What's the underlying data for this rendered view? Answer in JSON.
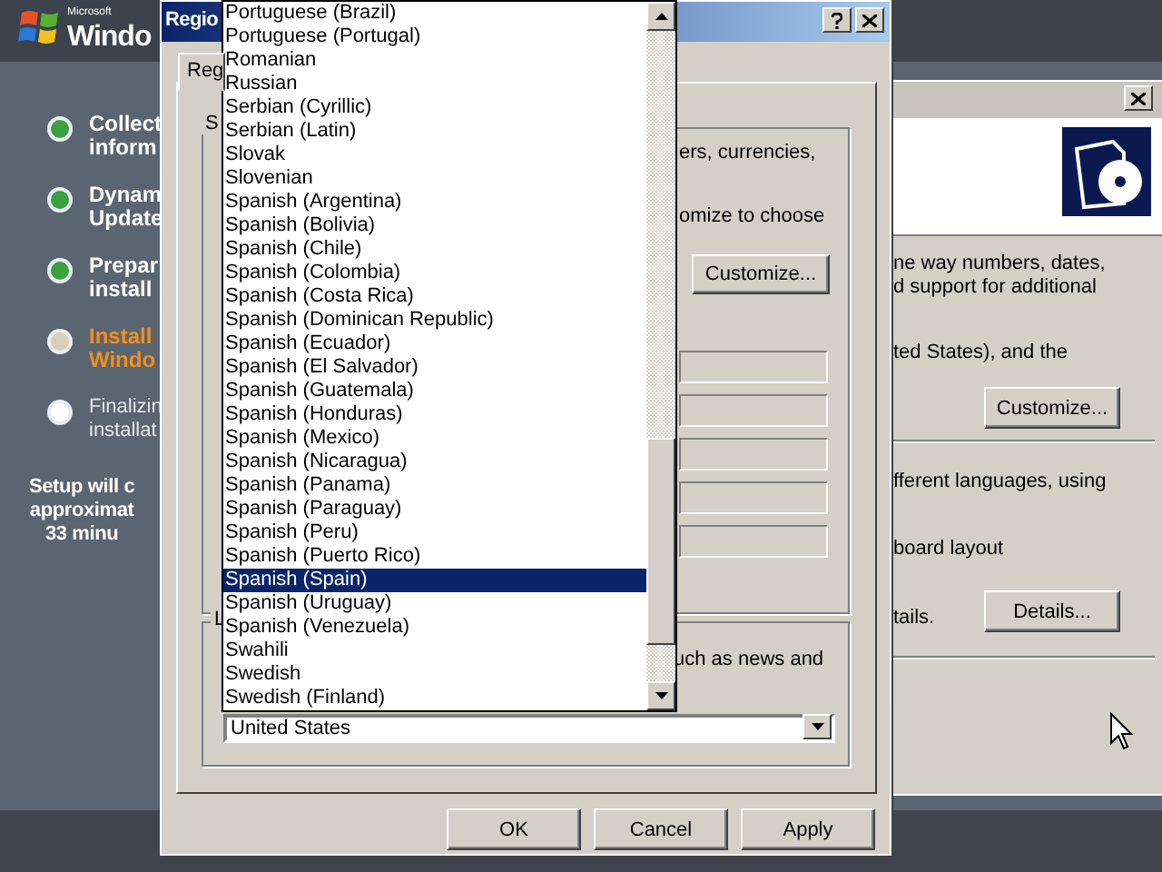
{
  "setup": {
    "brand_small": "Microsoft",
    "brand": "Windo",
    "steps": [
      {
        "lines": [
          "Collect",
          "inform"
        ],
        "completed": true,
        "active": false
      },
      {
        "lines": [
          "Dynam",
          "Update"
        ],
        "completed": true,
        "active": false
      },
      {
        "lines": [
          "Prepar",
          "install"
        ],
        "completed": true,
        "active": false
      },
      {
        "lines": [
          "Install",
          "Windo"
        ],
        "completed": false,
        "active": true
      },
      {
        "lines": [
          "Finalizin",
          "installat"
        ],
        "completed": false,
        "active": false
      }
    ],
    "estimate": [
      "Setup will c",
      "approximat",
      "33 minu"
    ]
  },
  "back_window": {
    "texts_1": [
      "ne way numbers, dates,",
      "d support for additional"
    ],
    "text_2": "ted States), and the",
    "customize_button": "Customize...",
    "text_3": "fferent languages, using",
    "text_4": "board layout",
    "text_5": "tails.",
    "details_button": "Details..."
  },
  "dialog": {
    "title": "Regio",
    "tab": {
      "label": "Reg",
      "selected": true
    },
    "group_1_label": "S",
    "group_1_lines": [
      "ers, currencies,",
      "omize to choose"
    ],
    "customize_button": "Customize...",
    "group_2_label": "L",
    "group_2_text": "uch as news and",
    "combo_value": "United States",
    "buttons": [
      "OK",
      "Cancel",
      "Apply"
    ]
  },
  "dropdown": {
    "items": [
      {
        "label": "Portuguese (Brazil)",
        "selected": false
      },
      {
        "label": "Portuguese (Portugal)",
        "selected": false
      },
      {
        "label": "Romanian",
        "selected": false
      },
      {
        "label": "Russian",
        "selected": false
      },
      {
        "label": "Serbian (Cyrillic)",
        "selected": false
      },
      {
        "label": "Serbian (Latin)",
        "selected": false
      },
      {
        "label": "Slovak",
        "selected": false
      },
      {
        "label": "Slovenian",
        "selected": false
      },
      {
        "label": "Spanish (Argentina)",
        "selected": false
      },
      {
        "label": "Spanish (Bolivia)",
        "selected": false
      },
      {
        "label": "Spanish (Chile)",
        "selected": false
      },
      {
        "label": "Spanish (Colombia)",
        "selected": false
      },
      {
        "label": "Spanish (Costa Rica)",
        "selected": false
      },
      {
        "label": "Spanish (Dominican Republic)",
        "selected": false
      },
      {
        "label": "Spanish (Ecuador)",
        "selected": false
      },
      {
        "label": "Spanish (El Salvador)",
        "selected": false
      },
      {
        "label": "Spanish (Guatemala)",
        "selected": false
      },
      {
        "label": "Spanish (Honduras)",
        "selected": false
      },
      {
        "label": "Spanish (Mexico)",
        "selected": false
      },
      {
        "label": "Spanish (Nicaragua)",
        "selected": false
      },
      {
        "label": "Spanish (Panama)",
        "selected": false
      },
      {
        "label": "Spanish (Paraguay)",
        "selected": false
      },
      {
        "label": "Spanish (Peru)",
        "selected": false
      },
      {
        "label": "Spanish (Puerto Rico)",
        "selected": false
      },
      {
        "label": "Spanish (Spain)",
        "selected": true
      },
      {
        "label": "Spanish (Uruguay)",
        "selected": false
      },
      {
        "label": "Spanish (Venezuela)",
        "selected": false
      },
      {
        "label": "Swahili",
        "selected": false
      },
      {
        "label": "Swedish",
        "selected": false
      },
      {
        "label": "Swedish (Finland)",
        "selected": false
      }
    ]
  }
}
